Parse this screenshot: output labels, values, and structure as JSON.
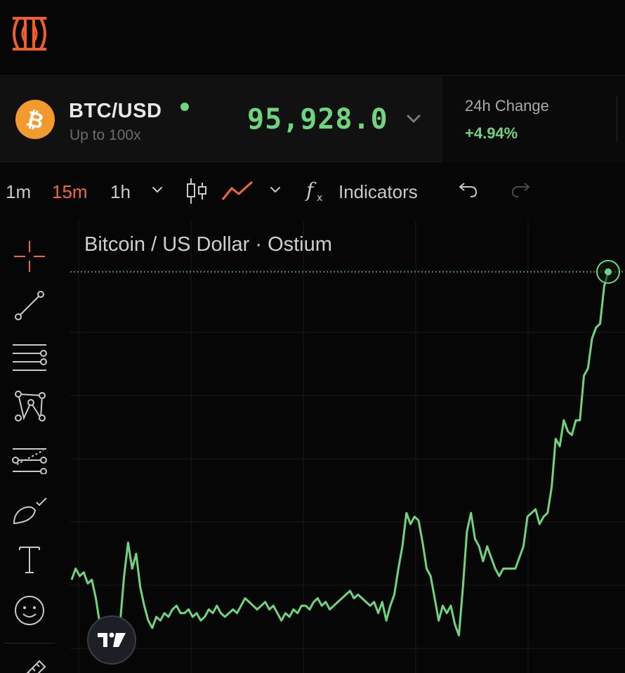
{
  "app": {
    "logo_icon": "ostium-logo-icon"
  },
  "ticker": {
    "pair": "BTC/USD",
    "coin_icon": "bitcoin-icon",
    "leverage": "Up to 100x",
    "price": "95,928.0",
    "change_label": "24h Change",
    "change_value": "+4.94%",
    "status_color": "#6fd47c"
  },
  "toolbar": {
    "intervals": [
      "1m",
      "15m",
      "1h"
    ],
    "active_interval": "15m",
    "indicators_label": "Indicators"
  },
  "chart": {
    "title": "Bitcoin / US Dollar · Ostium",
    "line_color": "#6fd47c"
  },
  "chart_data": {
    "type": "line",
    "title": "Bitcoin / US Dollar · Ostium",
    "last_price": 95928.0,
    "series": [
      {
        "values": [
          0.17,
          0.2,
          0.18,
          0.19,
          0.16,
          0.17,
          0.12,
          0.05,
          0.02,
          0.04,
          0.06,
          0.07,
          0.05,
          0.18,
          0.27,
          0.2,
          0.24,
          0.15,
          0.1,
          0.06,
          0.04,
          0.07,
          0.06,
          0.08,
          0.07,
          0.09,
          0.1,
          0.08,
          0.08,
          0.09,
          0.07,
          0.08,
          0.06,
          0.07,
          0.09,
          0.08,
          0.1,
          0.08,
          0.07,
          0.08,
          0.09,
          0.08,
          0.1,
          0.12,
          0.11,
          0.1,
          0.09,
          0.1,
          0.11,
          0.09,
          0.1,
          0.08,
          0.06,
          0.08,
          0.07,
          0.09,
          0.08,
          0.1,
          0.1,
          0.09,
          0.11,
          0.12,
          0.1,
          0.11,
          0.09,
          0.1,
          0.11,
          0.12,
          0.13,
          0.14,
          0.12,
          0.13,
          0.12,
          0.11,
          0.1,
          0.11,
          0.08,
          0.11,
          0.06,
          0.1,
          0.13,
          0.2,
          0.26,
          0.35,
          0.32,
          0.34,
          0.33,
          0.27,
          0.2,
          0.18,
          0.12,
          0.06,
          0.1,
          0.08,
          0.1,
          0.05,
          0.02,
          0.15,
          0.3,
          0.35,
          0.28,
          0.26,
          0.22,
          0.26,
          0.23,
          0.2,
          0.18,
          0.2,
          0.2,
          0.2,
          0.2,
          0.23,
          0.26,
          0.34,
          0.35,
          0.36,
          0.32,
          0.34,
          0.35,
          0.42,
          0.55,
          0.53,
          0.6,
          0.57,
          0.56,
          0.6,
          0.6,
          0.72,
          0.74,
          0.82,
          0.85,
          0.86,
          0.96,
          1.0
        ]
      }
    ],
    "grid": true
  }
}
